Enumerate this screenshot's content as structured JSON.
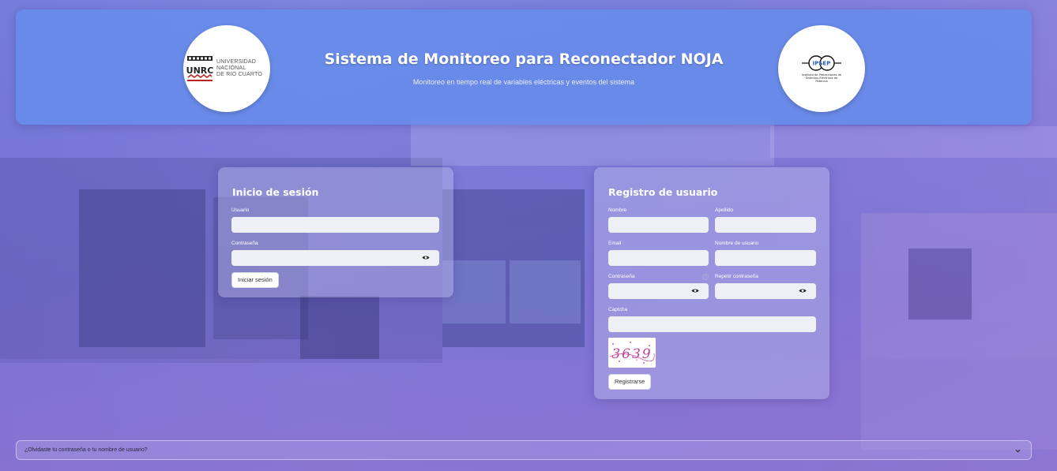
{
  "header": {
    "title": "Sistema de Monitoreo para Reconectador NOJA",
    "subtitle": "Monitoreo en tiempo real de variables eléctricas y eventos del sistema",
    "logo_left": {
      "mark": "UNRC",
      "lines": [
        "UNIVERSIDAD",
        "NACIONAL",
        "DE RIO CUARTO"
      ]
    },
    "logo_right": {
      "mark": "IPSEP",
      "subtitle": "Instituto de Protecciones de Sistemas Eléctricos de Potencia"
    }
  },
  "login": {
    "title": "Inicio de sesión",
    "user_label": "Usuario",
    "user_value": "",
    "password_label": "Contraseña",
    "password_value": "",
    "submit_label": "Iniciar sesión"
  },
  "register": {
    "title": "Registro de usuario",
    "name_label": "Nombre",
    "lastname_label": "Apellido",
    "email_label": "Email",
    "username_label": "Nombre de usuario",
    "password_label": "Contraseña",
    "repeat_password_label": "Repetir contraseña",
    "captcha_label": "Captcha",
    "captcha_text": "3639",
    "help_icon": "?",
    "submit_label": "Registrarse"
  },
  "forgot": {
    "label": "¿Olvidaste tu contraseña o tu nombre de usuario?"
  },
  "icons": {
    "eye": "eye-icon",
    "chevron": "chevron-down-icon",
    "help": "question-circle-icon"
  },
  "colors": {
    "header_bg": "#6a8ceb",
    "input_bg": "#eff0f5",
    "captcha_ink": "#c2409a"
  }
}
